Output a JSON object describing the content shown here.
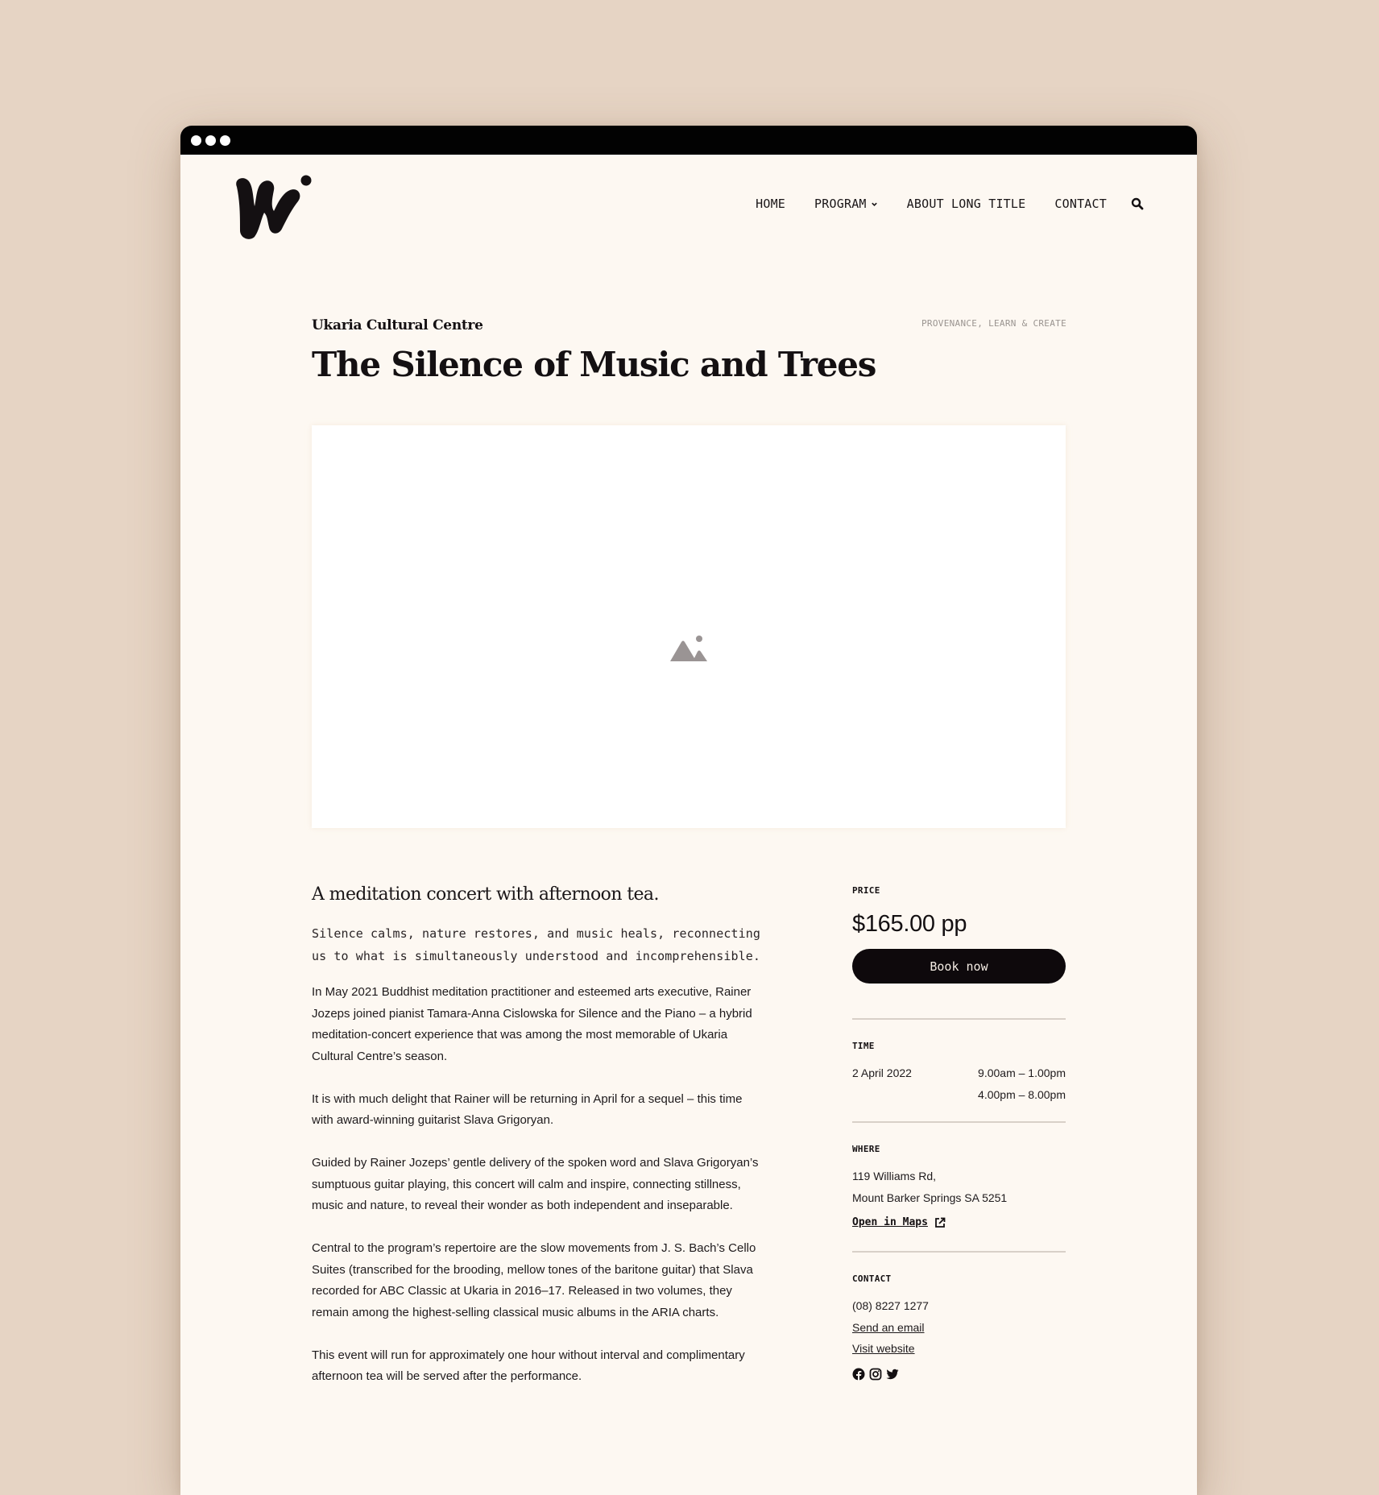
{
  "window": {
    "titlebar_dots": 3
  },
  "nav": {
    "items": [
      {
        "label": "HOME"
      },
      {
        "label": "PROGRAM",
        "has_dropdown": true
      },
      {
        "label": "ABOUT LONG TITLE"
      },
      {
        "label": "CONTACT"
      }
    ],
    "search_icon": "search-icon"
  },
  "event": {
    "venue": "Ukaria Cultural Centre",
    "category": "PROVENANCE, LEARN & CREATE",
    "title": "The Silence of Music and Trees",
    "hero_placeholder_icon": "image-placeholder-icon",
    "lead": "A meditation concert with afternoon tea.",
    "intro": "Silence calms, nature restores, and music heals, reconnecting us to what is simultaneously understood and incomprehensible.",
    "paragraphs": [
      "In May 2021 Buddhist meditation practitioner and esteemed arts executive, Rainer Jozeps joined pianist Tamara-Anna Cislowska for Silence and the Piano – a hybrid meditation-concert experience that was among the most memorable of Ukaria Cultural Centre’s season.",
      "It is with much delight that Rainer will be returning in April for a sequel – this time with award-winning guitarist Slava Grigoryan.",
      "Guided by Rainer Jozeps’ gentle delivery of the spoken word and Slava Grigoryan’s sumptuous guitar playing, this concert will calm and inspire, connecting stillness, music and nature, to reveal their wonder as both independent and inseparable.",
      "Central to the program’s repertoire are the slow movements from J. S. Bach’s Cello Suites (transcribed for the brooding, mellow tones of the baritone guitar) that Slava recorded for ABC Classic at Ukaria in 2016–17. Released in two volumes, they remain among the highest-selling classical music albums in the ARIA charts.",
      "This event will run for approximately one hour without interval and complimentary afternoon tea will be served after the performance."
    ]
  },
  "sidebar": {
    "price": {
      "label": "PRICE",
      "value": "$165.00 pp",
      "button": "Book now"
    },
    "time": {
      "label": "TIME",
      "date": "2 April 2022",
      "slots": [
        "9.00am – 1.00pm",
        "4.00pm – 8.00pm"
      ]
    },
    "where": {
      "label": "WHERE",
      "address_line1": "119 Williams Rd,",
      "address_line2": "Mount Barker Springs SA 5251",
      "maps_link": "Open in Maps"
    },
    "contact": {
      "label": "CONTACT",
      "phone": "(08) 8227 1277",
      "email_link": "Send an email",
      "website_link": "Visit website",
      "socials": [
        "facebook",
        "instagram",
        "twitter"
      ]
    }
  },
  "colors": {
    "page_bg": "#e6d4c4",
    "window_bg": "#fdf8f2",
    "titlebar": "#020202",
    "text": "#141012",
    "muted": "#9a9490",
    "button_bg": "#0e090c",
    "divider": "#d8d0c8"
  }
}
